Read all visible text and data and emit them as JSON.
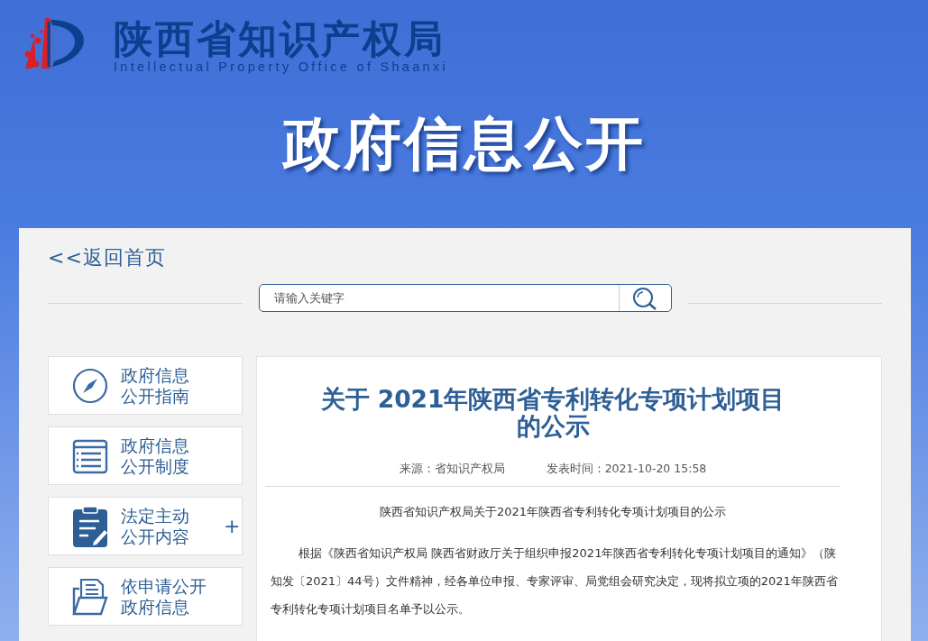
{
  "header": {
    "site_name": "陕西省知识产权局",
    "site_name_en": "Intellectual Property Office of Shaanxi",
    "banner_title": "政府信息公开"
  },
  "back_link": "<<返回首页",
  "search": {
    "placeholder": "请输入关键字"
  },
  "sidebar": {
    "items": [
      {
        "kind": "compass",
        "label": "政府信息公开指南"
      },
      {
        "kind": "list",
        "label": "政府信息公开制度"
      },
      {
        "kind": "clipboard",
        "label": "法定主动公开内容",
        "toggle": "+"
      },
      {
        "kind": "folder",
        "label": "依申请公开政府信息"
      }
    ]
  },
  "article": {
    "title": "关于 2021年陕西省专利转化专项计划项目的公示",
    "source": "来源：省知识产权局",
    "published": "发表时间：2021-10-20 15:58",
    "paragraphs": [
      {
        "kind": "center",
        "text": "陕西省知识产权局关于2021年陕西省专利转化专项计划项目的公示"
      },
      {
        "kind": "indent",
        "text": "根据《陕西省知识产权局 陕西省财政厅关于组织申报2021年陕西省专利转化专项计划项目的通知》（陕知发〔2021〕44号）文件精神，经各单位申报、专家评审、局党组会研究决定，现将拟立项的2021年陕西省专利转化专项计划项目名单予以公示。"
      }
    ]
  }
}
